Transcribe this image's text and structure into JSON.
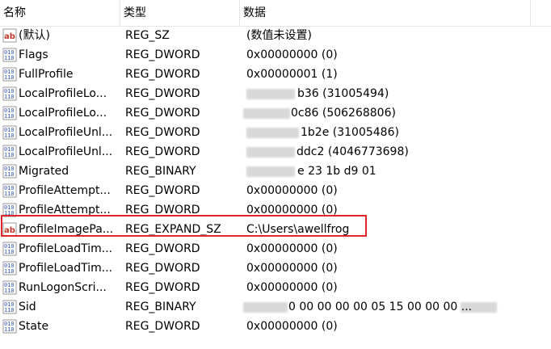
{
  "header": {
    "name": "名称",
    "type": "类型",
    "data": "数据"
  },
  "rows": [
    {
      "name": "(默认)",
      "type": "REG_SZ",
      "data": "(数值未设置)",
      "icon": "string-value-icon"
    },
    {
      "name": "Flags",
      "type": "REG_DWORD",
      "data": "0x00000000 (0)",
      "icon": "binary-value-icon"
    },
    {
      "name": "FullProfile",
      "type": "REG_DWORD",
      "data": "0x00000001 (1)",
      "icon": "binary-value-icon"
    },
    {
      "name": "LocalProfileLo...",
      "type": "REG_DWORD",
      "data": "b36 (31005494)",
      "icon": "binary-value-icon"
    },
    {
      "name": "LocalProfileLo...",
      "type": "REG_DWORD",
      "data": "0c86 (506268806)",
      "icon": "binary-value-icon"
    },
    {
      "name": "LocalProfileUnl...",
      "type": "REG_DWORD",
      "data": "1b2e (31005486)",
      "icon": "binary-value-icon"
    },
    {
      "name": "LocalProfileUnl...",
      "type": "REG_DWORD",
      "data": "ddc2 (4046773698)",
      "icon": "binary-value-icon"
    },
    {
      "name": "Migrated",
      "type": "REG_BINARY",
      "data": "e 23 1b d9 01",
      "icon": "binary-value-icon"
    },
    {
      "name": "ProfileAttempt...",
      "type": "REG_DWORD",
      "data": "0x00000000 (0)",
      "icon": "binary-value-icon"
    },
    {
      "name": "ProfileAttempt...",
      "type": "REG_DWORD",
      "data": "0x00000000 (0)",
      "icon": "binary-value-icon"
    },
    {
      "name": "ProfileImagePa...",
      "type": "REG_EXPAND_SZ",
      "data": "C:\\Users\\awellfrog",
      "icon": "string-value-icon"
    },
    {
      "name": "ProfileLoadTim...",
      "type": "REG_DWORD",
      "data": "0x00000000 (0)",
      "icon": "binary-value-icon"
    },
    {
      "name": "ProfileLoadTim...",
      "type": "REG_DWORD",
      "data": "0x00000000 (0)",
      "icon": "binary-value-icon"
    },
    {
      "name": "RunLogonScri...",
      "type": "REG_DWORD",
      "data": "0x00000000 (0)",
      "icon": "binary-value-icon"
    },
    {
      "name": "Sid",
      "type": "REG_BINARY",
      "data": "0 00 00 00 00 05 15 00 00 00 ...",
      "icon": "binary-value-icon"
    },
    {
      "name": "State",
      "type": "REG_DWORD",
      "data": "0x00000000 (0)",
      "icon": "binary-value-icon"
    }
  ],
  "colors": {
    "highlight": "#e0252b",
    "string_icon": "#c0392b",
    "binary_icon": "#2a5aa8"
  }
}
